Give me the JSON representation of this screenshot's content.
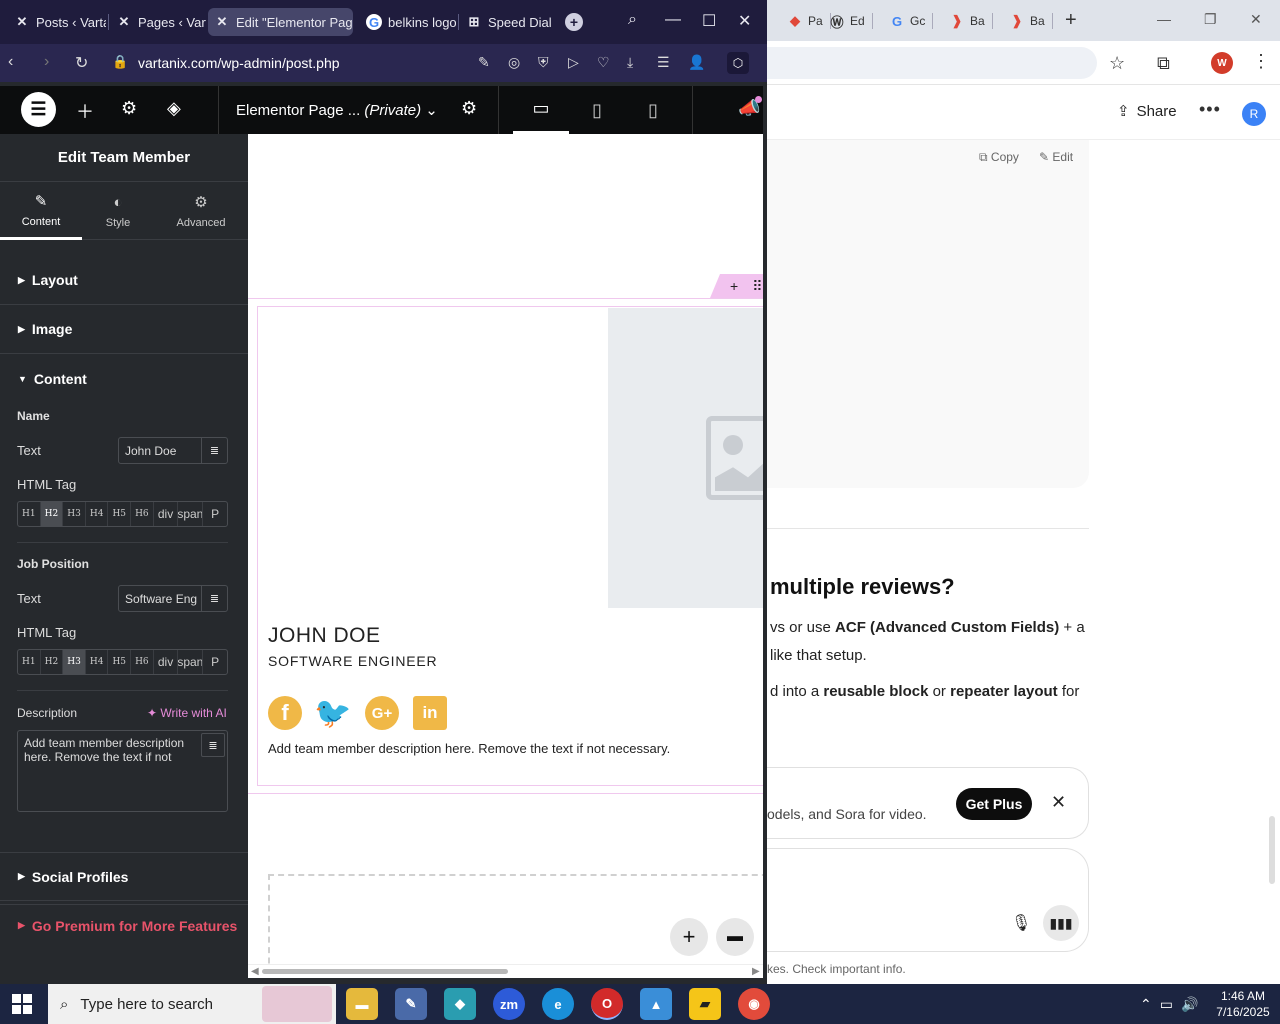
{
  "chrome_right": {
    "tabs": [
      {
        "label": "Pa",
        "icon": "red-diamond-icon",
        "color": "#e0483a"
      },
      {
        "label": "Ed",
        "icon": "wordpress-icon",
        "color": "#333333"
      },
      {
        "label": "Gc",
        "icon": "google-icon",
        "color": "#4285f4"
      },
      {
        "label": "Ba",
        "icon": "red-logo-icon",
        "color": "#e0483a"
      },
      {
        "label": "Ba",
        "icon": "red-logo-icon",
        "color": "#e0483a"
      }
    ],
    "profile_letter": "W",
    "chatgpt": {
      "share_label": "Share",
      "avatar_letter": "R",
      "copy_label": "Copy",
      "edit_label": "Edit",
      "heading": "multiple reviews?",
      "para1_prefix": "vs or use ",
      "para1_bold": "ACF (Advanced Custom Fields)",
      "para1_suffix": " + a",
      "para2": "like that setup.",
      "para3_prefix": "d into a ",
      "para3_bold1": "reusable block",
      "para3_mid": " or ",
      "para3_bold2": "repeater layout",
      "para3_suffix": " for",
      "plus_text": "odels, and Sora for video.",
      "get_plus_label": "Get Plus",
      "disclaimer": "kes. Check important info."
    }
  },
  "browser_left": {
    "tabs": [
      {
        "label": "Posts ‹ Vartar",
        "icon": "wordpress-x-icon"
      },
      {
        "label": "Pages ‹ Varta",
        "icon": "wordpress-x-icon"
      },
      {
        "label": "Edit \"Elementor Page",
        "icon": "wordpress-x-icon"
      },
      {
        "label": "belkins logo",
        "icon": "google-icon"
      },
      {
        "label": "Speed Dial",
        "icon": "grid-icon"
      }
    ],
    "url": "vartanix.com/wp-admin/post.php"
  },
  "elementor": {
    "page_title": "Elementor Page ...",
    "page_status": "(Private)",
    "panel": {
      "title": "Edit Team Member",
      "tabs": [
        "Content",
        "Style",
        "Advanced"
      ],
      "sections": {
        "layout": "Layout",
        "image": "Image",
        "content": "Content",
        "social": "Social Profiles",
        "premium": "Go Premium for More Features"
      },
      "name_heading": "Name",
      "name_text_label": "Text",
      "name_text_value": "John Doe",
      "html_tag_label": "HTML Tag",
      "job_heading": "Job Position",
      "job_text_label": "Text",
      "job_text_value": "Software Eng",
      "job_html_tag_label": "HTML Tag",
      "tags": [
        "H1",
        "H2",
        "H3",
        "H4",
        "H5",
        "H6",
        "div",
        "span",
        "P"
      ],
      "name_selected_tag": "H2",
      "job_selected_tag": "H3",
      "description_label": "Description",
      "write_ai_label": "Write with AI",
      "description_value": "Add team member description here. Remove the text if not necessary."
    },
    "canvas": {
      "member_name": "JOHN DOE",
      "member_job": "SOFTWARE ENGINEER",
      "member_description": "Add team member description here. Remove the text if not necessary.",
      "social_color": "#f0b847"
    }
  },
  "taskbar": {
    "search_placeholder": "Type here to search",
    "time": "1:46 AM",
    "date": "7/16/2025"
  }
}
